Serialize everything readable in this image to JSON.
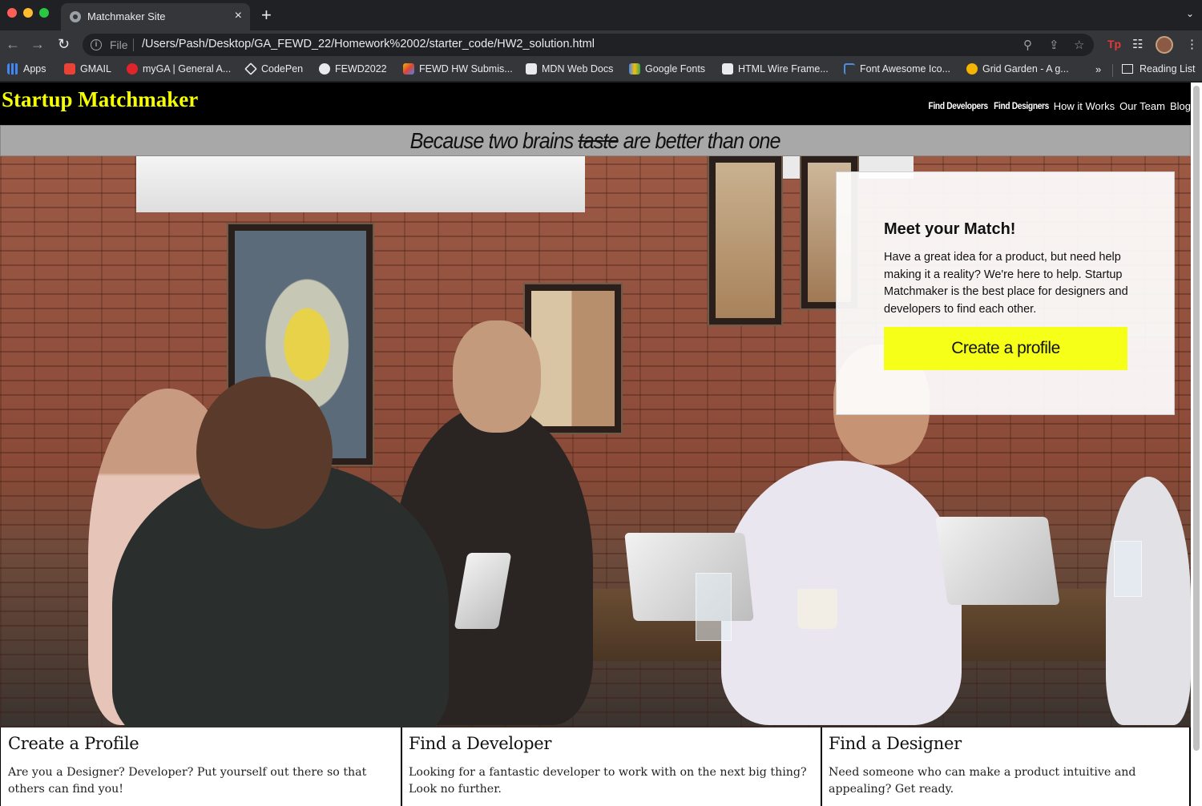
{
  "browser": {
    "tab_title": "Matchmaker Site",
    "tab_close": "×",
    "new_tab": "+",
    "scheme_label": "File",
    "url": "/Users/Pash/Desktop/GA_FEWD_22/Homework%2002/starter_code/HW2_solution.html",
    "tp_label": "Tp",
    "bookmarks": [
      {
        "label": "Apps",
        "icon": "apps-icon"
      },
      {
        "label": "GMAIL",
        "icon": "gmail-icon"
      },
      {
        "label": "myGA | General A...",
        "icon": "myga-icon"
      },
      {
        "label": "CodePen",
        "icon": "codepen-icon"
      },
      {
        "label": "FEWD2022",
        "icon": "github-icon"
      },
      {
        "label": "FEWD HW Submis...",
        "icon": "fewd-hw-icon"
      },
      {
        "label": "MDN Web Docs",
        "icon": "mdn-icon"
      },
      {
        "label": "Google Fonts",
        "icon": "google-fonts-icon"
      },
      {
        "label": "HTML Wire Frame...",
        "icon": "wireframe-icon"
      },
      {
        "label": "Font Awesome Ico...",
        "icon": "font-awesome-icon"
      },
      {
        "label": "Grid Garden - A g...",
        "icon": "grid-garden-icon"
      }
    ],
    "bookmarks_overflow": "»",
    "reading_list": "Reading List"
  },
  "site": {
    "logo": "Startup Matchmaker",
    "nav": [
      "Find Developers",
      "Find Designers",
      "How it Works",
      "Our Team",
      "Blog"
    ],
    "tagline": {
      "before": "Because two brains ",
      "struck": "taste",
      "highlight": "are",
      "after": " better than one"
    },
    "hero_card": {
      "title": "Meet your Match!",
      "body": "Have a great idea for a product, but need help making it a reality? We're here to help. Startup Matchmaker is the best place for designers and developers to find each other.",
      "cta": "Create a profile"
    },
    "features": [
      {
        "title": "Create a Profile",
        "text": "Are you a Designer? Developer? Put yourself out there so that others can find you!"
      },
      {
        "title": "Find a Developer",
        "text": "Looking for a fantastic developer to work with on the next big thing? Look no further."
      },
      {
        "title": "Find a Designer",
        "text": "Need someone who can make a product intuitive and appealing? Get ready."
      }
    ]
  },
  "colors": {
    "accent_yellow": "#f5ff18",
    "header_bg": "#000000",
    "tagline_bg": "#a8a8a8"
  }
}
